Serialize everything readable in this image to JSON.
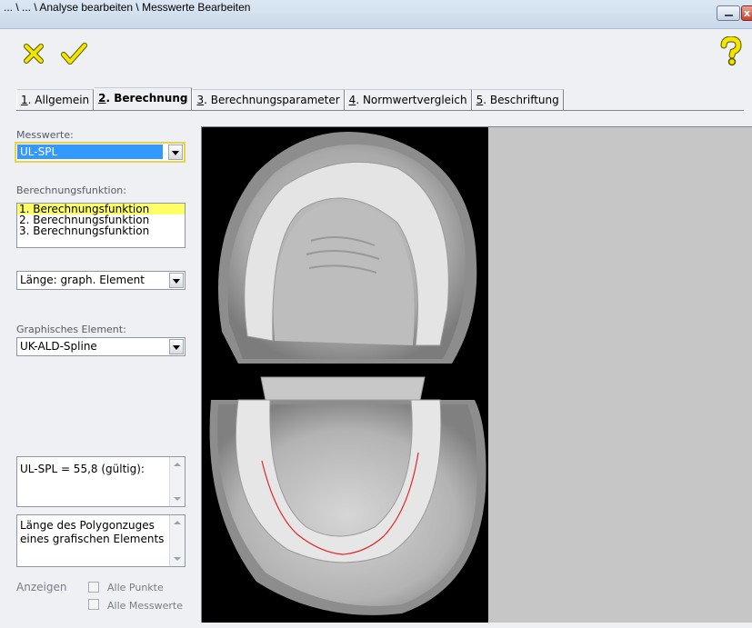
{
  "window": {
    "title": "... \\ ... \\ Analyse bearbeiten \\ Messwerte Bearbeiten",
    "close_glyph": "x"
  },
  "toolbar": {
    "cancel_icon": "cancel-x-icon",
    "confirm_icon": "checkmark-icon",
    "help_icon": "help-question-icon",
    "icon_color": "#f2e600"
  },
  "tabs": [
    {
      "num": "1",
      "label": ". Allgemein",
      "active": false
    },
    {
      "num": "2",
      "label": ". Berechnung",
      "active": true
    },
    {
      "num": "3",
      "label": ". Berechnungsparameter",
      "active": false
    },
    {
      "num": "4",
      "label": ". Normwertvergleich",
      "active": false
    },
    {
      "num": "5",
      "label": ". Beschriftung",
      "active": false
    }
  ],
  "left_panel": {
    "messwerte_label": "Messwerte:",
    "messwerte_value": "UL-SPL",
    "berechnungsfunktion_label": "Berechnungsfunktion:",
    "berechnungsfunktionen": [
      {
        "label": "1. Berechnungsfunktion",
        "selected": true
      },
      {
        "label": "2. Berechnungsfunktion",
        "selected": false
      },
      {
        "label": "3. Berechnungsfunktion",
        "selected": false
      }
    ],
    "laenge_value": "Länge: graph. Element",
    "graphisches_element_label": "Graphisches Element:",
    "graphisches_element_value": "UK-ALD-Spline",
    "result_text": "UL-SPL = 55,8 (gültig):",
    "description_text": "Länge des Polygonzuges eines grafischen Elements",
    "anzeigen_label": "Anzeigen",
    "alle_punkte_label": "Alle Punkte",
    "alle_messwerte_label": "Alle Messwerte"
  },
  "image": {
    "spline_color": "#e0282a",
    "background_color": "#c6c6c6"
  }
}
